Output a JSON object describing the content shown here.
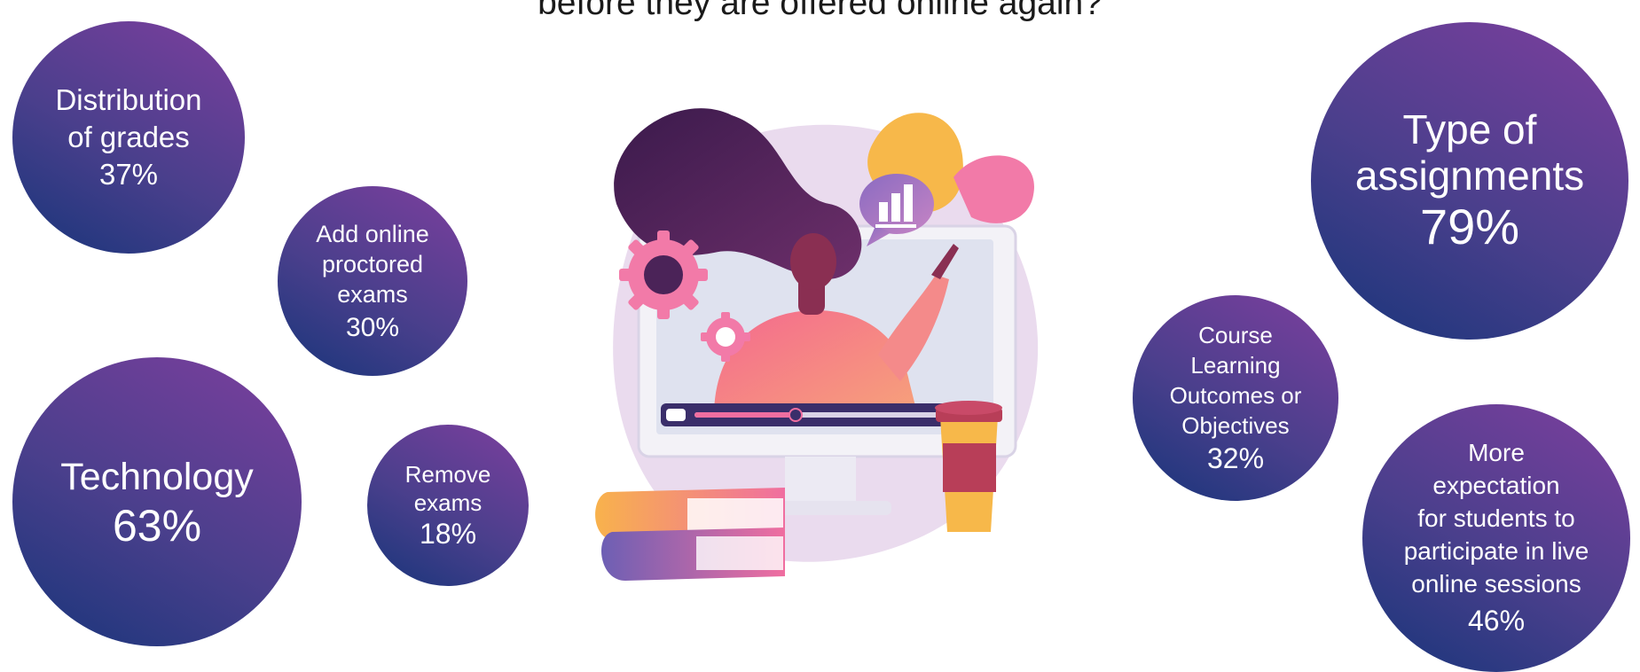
{
  "title": "before they are offered online again?",
  "bubbles": {
    "distribution": {
      "label": "Distribution\nof grades",
      "percent": "37%"
    },
    "proctored": {
      "label": "Add online\nproctored\nexams",
      "percent": "30%"
    },
    "technology": {
      "label": "Technology",
      "percent": "63%"
    },
    "remove": {
      "label": "Remove\nexams",
      "percent": "18%"
    },
    "type": {
      "label": "Type of\nassignments",
      "percent": "79%"
    },
    "clo": {
      "label": "Course\nLearning\nOutcomes or\nObjectives",
      "percent": "32%"
    },
    "expectation": {
      "label": "More\nexpectation\nfor students to\nparticipate in live\nonline sessions",
      "percent": "46%"
    }
  },
  "colors": {
    "bubble_dark": "#17357a",
    "bubble_light": "#7d3f9e",
    "illustration_bg": "#eadbee",
    "hair": "#4b2358",
    "skin": "#8a2f52",
    "shirt": "#f07f8a",
    "yellow": "#f7b84a",
    "pink": "#f27aa8"
  },
  "icons": [
    "gear-icon",
    "bar-chart-icon",
    "coffee-cup-icon",
    "books-icon",
    "monitor-icon"
  ]
}
